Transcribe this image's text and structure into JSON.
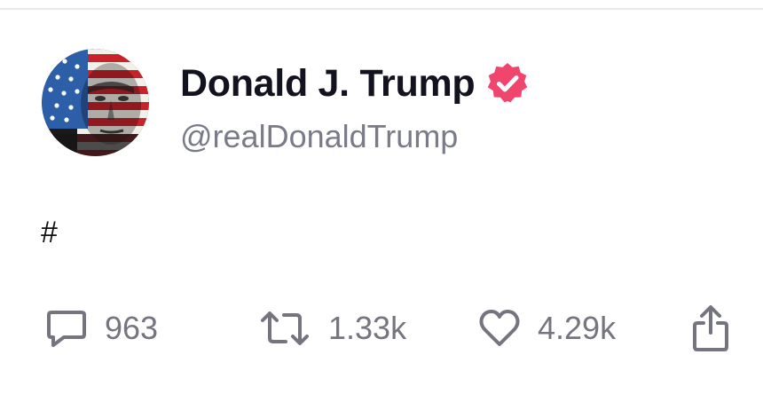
{
  "post": {
    "author": {
      "display_name": "Donald J. Trump",
      "handle": "@realDonaldTrump",
      "verified": true,
      "verified_color": "#f0466e",
      "avatar_icon": "flag-portrait-avatar"
    },
    "text": "#",
    "actions": {
      "replies": {
        "icon": "comment-icon",
        "count": "963"
      },
      "reposts": {
        "icon": "repost-icon",
        "count": "1.33k"
      },
      "likes": {
        "icon": "heart-icon",
        "count": "4.29k"
      },
      "share": {
        "icon": "share-icon"
      }
    }
  },
  "colors": {
    "name": "#13131f",
    "handle": "#7a7b88",
    "action": "#74757f"
  }
}
